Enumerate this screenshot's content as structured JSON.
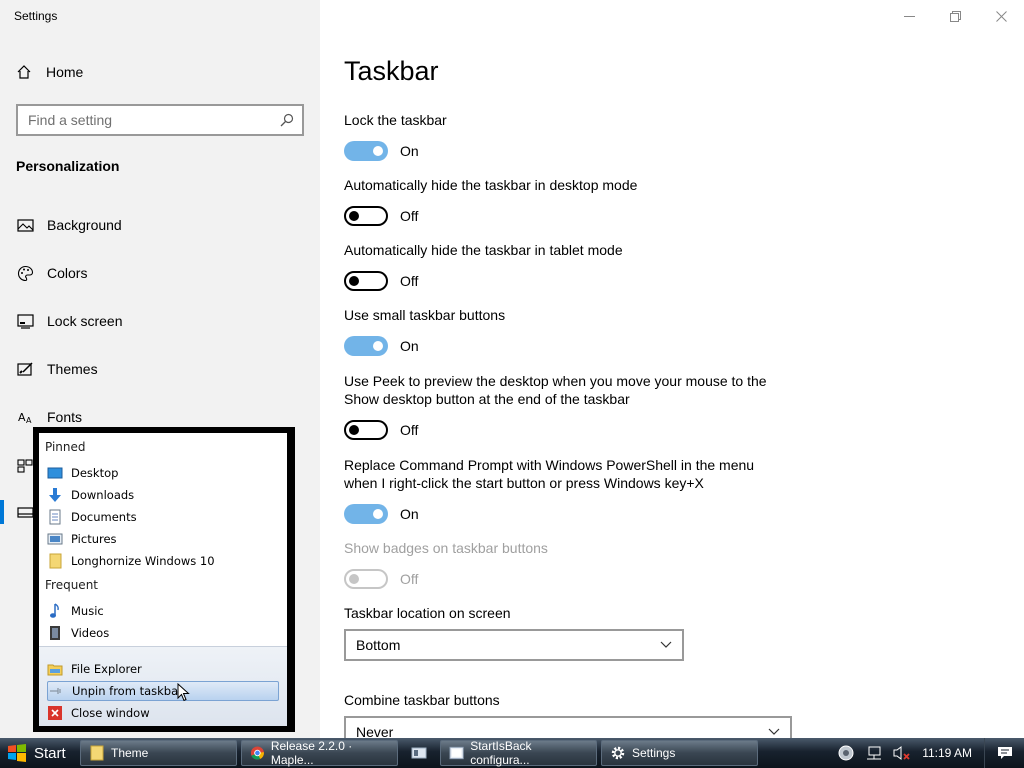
{
  "window": {
    "title": "Settings"
  },
  "sidebar": {
    "home_label": "Home",
    "search_placeholder": "Find a setting",
    "section_title": "Personalization",
    "items": [
      {
        "label": "Background",
        "icon": "image-icon"
      },
      {
        "label": "Colors",
        "icon": "palette-icon"
      },
      {
        "label": "Lock screen",
        "icon": "lock-screen-icon"
      },
      {
        "label": "Themes",
        "icon": "themes-icon"
      },
      {
        "label": "Fonts",
        "icon": "fonts-icon"
      },
      {
        "label": "",
        "icon": "start-icon"
      },
      {
        "label": "",
        "icon": "taskbar-icon"
      }
    ]
  },
  "main": {
    "title": "Taskbar",
    "settings": [
      {
        "label": "Lock the taskbar",
        "state": "On"
      },
      {
        "label": "Automatically hide the taskbar in desktop mode",
        "state": "Off"
      },
      {
        "label": "Automatically hide the taskbar in tablet mode",
        "state": "Off"
      },
      {
        "label": "Use small taskbar buttons",
        "state": "On"
      },
      {
        "label": "Use Peek to preview the desktop when you move your mouse to the Show desktop button at the end of the taskbar",
        "state": "Off"
      },
      {
        "label": "Replace Command Prompt with Windows PowerShell in the menu when I right-click the start button or press Windows key+X",
        "state": "On"
      },
      {
        "label": "Show badges on taskbar buttons",
        "state": "Off"
      }
    ],
    "location_label": "Taskbar location on screen",
    "location_value": "Bottom",
    "combine_label": "Combine taskbar buttons",
    "combine_value": "Never"
  },
  "jumplist": {
    "pinned_header": "Pinned",
    "pinned": [
      "Desktop",
      "Downloads",
      "Documents",
      "Pictures",
      "Longhornize Windows 10"
    ],
    "frequent_header": "Frequent",
    "frequent": [
      "Music",
      "Videos"
    ],
    "tasks": [
      "File Explorer",
      "Unpin from taskbar",
      "Close window"
    ]
  },
  "taskbar": {
    "start_label": "Start",
    "buttons": [
      "Theme",
      "Release 2.2.0 · Maple...",
      "",
      "StartIsBack configura...",
      "Settings"
    ],
    "clock": "11:19 AM"
  },
  "colors": {
    "accent": "#0078d7"
  }
}
